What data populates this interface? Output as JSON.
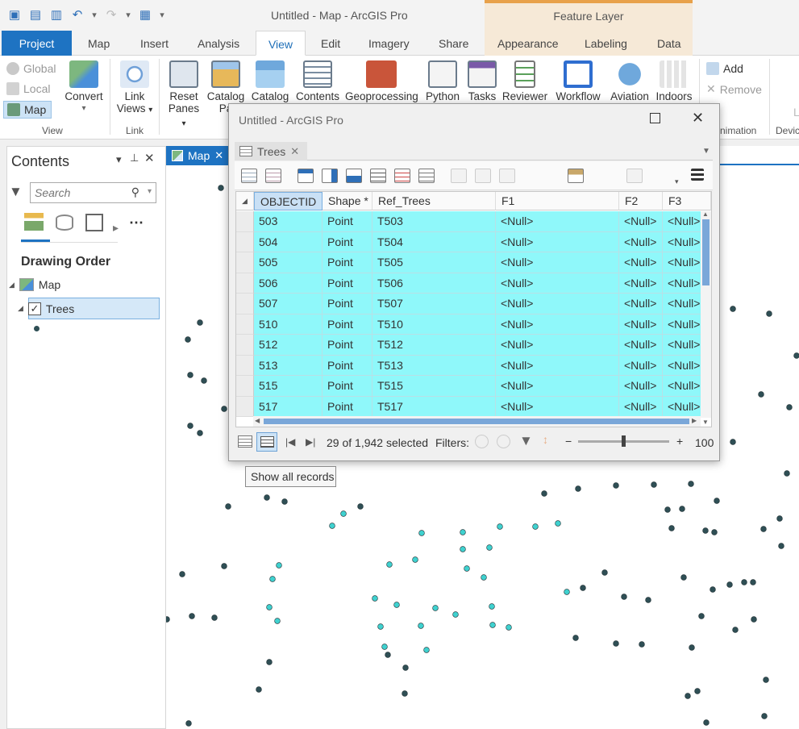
{
  "titlebar": {
    "title": "Untitled - Map - ArcGIS Pro",
    "context_group": "Feature Layer"
  },
  "tabs": [
    "Project",
    "Map",
    "Insert",
    "Analysis",
    "View",
    "Edit",
    "Imagery",
    "Share",
    "Appearance",
    "Labeling",
    "Data"
  ],
  "active_tab": "View",
  "ribbon": {
    "view_group": {
      "global": "Global",
      "local": "Local",
      "map": "Map",
      "convert": "Convert",
      "label": "View"
    },
    "link_group": {
      "link_views_1": "Link",
      "link_views_2": "Views",
      "label": "Link"
    },
    "windows": {
      "reset_panes_1": "Reset",
      "reset_panes_2": "Panes",
      "catalog_pane_1": "Catalog",
      "catalog_pane_2": "Pa",
      "catalog": "Catalog",
      "contents": "Contents",
      "geoprocessing": "Geoprocessing",
      "python": "Python",
      "tasks": "Tasks",
      "reviewer": "Reviewer",
      "workflow": "Workflow",
      "aviation": "Aviation",
      "indoors": "Indoors"
    },
    "add": "Add",
    "remove": "Remove",
    "animation_label": "nimation",
    "device_label": "Devic",
    "letter_l": "L"
  },
  "contents": {
    "title": "Contents",
    "search_placeholder": "Search",
    "drawing_order": "Drawing Order",
    "map_item": "Map",
    "layer_item": "Trees"
  },
  "map_tab": "Map",
  "table_window": {
    "title": "Untitled - ArcGIS Pro",
    "tab": "Trees",
    "columns": [
      "OBJECTID *",
      "Shape *",
      "Ref_Trees",
      "F1",
      "F2",
      "F3"
    ],
    "rows": [
      [
        "503",
        "Point",
        "T503",
        "<Null>",
        "<Null>",
        "<Null>"
      ],
      [
        "504",
        "Point",
        "T504",
        "<Null>",
        "<Null>",
        "<Null>"
      ],
      [
        "505",
        "Point",
        "T505",
        "<Null>",
        "<Null>",
        "<Null>"
      ],
      [
        "506",
        "Point",
        "T506",
        "<Null>",
        "<Null>",
        "<Null>"
      ],
      [
        "507",
        "Point",
        "T507",
        "<Null>",
        "<Null>",
        "<Null>"
      ],
      [
        "510",
        "Point",
        "T510",
        "<Null>",
        "<Null>",
        "<Null>"
      ],
      [
        "512",
        "Point",
        "T512",
        "<Null>",
        "<Null>",
        "<Null>"
      ],
      [
        "513",
        "Point",
        "T513",
        "<Null>",
        "<Null>",
        "<Null>"
      ],
      [
        "515",
        "Point",
        "T515",
        "<Null>",
        "<Null>",
        "<Null>"
      ],
      [
        "517",
        "Point",
        "T517",
        "<Null>",
        "<Null>",
        "<Null>"
      ]
    ],
    "status": {
      "selected_text": "29 of 1,942 selected",
      "filters_label": "Filters:",
      "zoom": "100"
    },
    "tooltip": "Show all records"
  },
  "colors": {
    "accent": "#1e73c2",
    "selected_row": "#8ff8fa",
    "point_dark": "#2f4f55",
    "point_selected": "#3fd1cf"
  }
}
